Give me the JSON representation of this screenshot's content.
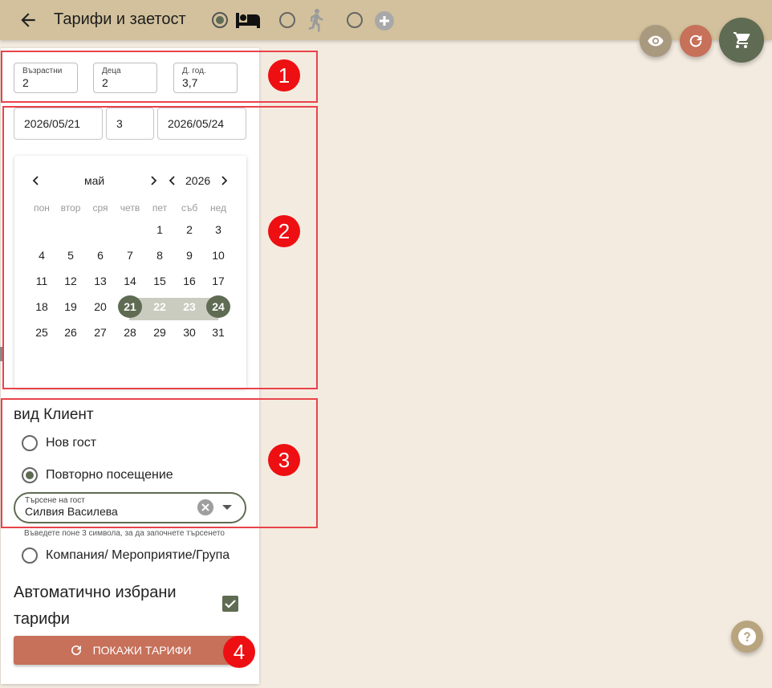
{
  "header": {
    "title": "Тарифи и заетост",
    "modes": [
      {
        "icon": "bed-icon",
        "checked": true
      },
      {
        "icon": "running-person-icon",
        "checked": false
      },
      {
        "icon": "add-circle-icon",
        "checked": false
      }
    ]
  },
  "colors": {
    "topbar": "#d2c19c",
    "accent": "#5f6b52",
    "action": "#c7705a",
    "background": "#f4ebe0",
    "annotation": "#ee0f12"
  },
  "occupancy": {
    "adults": {
      "label": "Възрастни",
      "value": "2"
    },
    "children": {
      "label": "Деца",
      "value": "2"
    },
    "ages": {
      "label": "Д. год.",
      "value": "3,7"
    }
  },
  "dates": {
    "from": "2026/05/21",
    "nights": "3",
    "to": "2026/05/24"
  },
  "calendar": {
    "month": "май",
    "year": "2026",
    "weekdays": [
      "пон",
      "втор",
      "сря",
      "четв",
      "пет",
      "съб",
      "нед"
    ],
    "weeks": [
      [
        "",
        "",
        "",
        "",
        "1",
        "2",
        "3"
      ],
      [
        "4",
        "5",
        "6",
        "7",
        "8",
        "9",
        "10"
      ],
      [
        "11",
        "12",
        "13",
        "14",
        "15",
        "16",
        "17"
      ],
      [
        "18",
        "19",
        "20",
        "21",
        "22",
        "23",
        "24"
      ],
      [
        "25",
        "26",
        "27",
        "28",
        "29",
        "30",
        "31"
      ]
    ],
    "selected_start": "21",
    "selected_end": "24"
  },
  "client": {
    "title": "вид Клиент",
    "new_guest": "Нов гост",
    "repeat_visit": "Повторно посещение",
    "company": "Компания/ Мероприятие/Група",
    "search_label": "Търсене на гост",
    "search_value": "Силвия Василева",
    "hint": "Въведете поне 3 символа, за да започнете търсенето"
  },
  "auto_rates_label": "Автоматично избрани тарифи",
  "show_rates_button": "ПОКАЖИ ТАРИФИ",
  "annotations": [
    "1",
    "2",
    "3",
    "4"
  ]
}
